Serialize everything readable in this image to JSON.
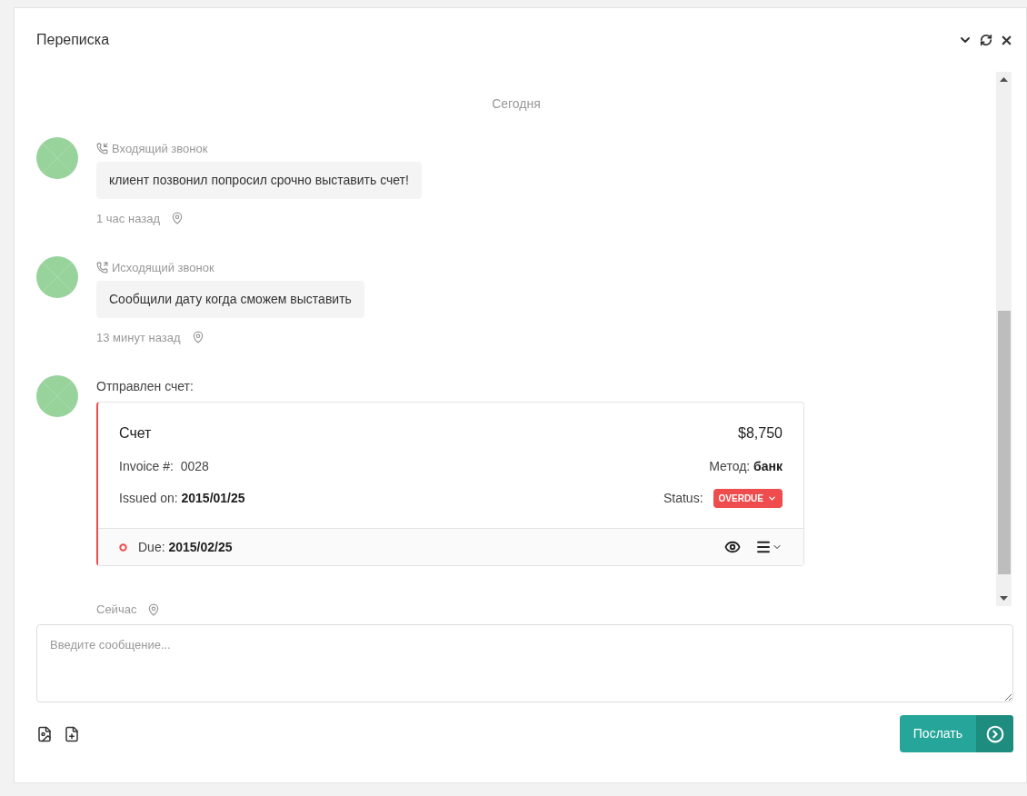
{
  "panel": {
    "title": "Переписка"
  },
  "feed": {
    "date_divider": "Сегодня",
    "items": [
      {
        "kind": "incoming_call",
        "label": "Входящий звонок",
        "text": "клиент позвонил попросил срочно выставить счет!",
        "time": "1 час назад"
      },
      {
        "kind": "outgoing_call",
        "label": "Исходящий звонок",
        "text": "Сообщили дату когда сможем выставить",
        "time": "13 минут назад"
      },
      {
        "kind": "invoice",
        "label": "Отправлен счет:",
        "invoice": {
          "title": "Счет",
          "amount": "$8,750",
          "number_label": "Invoice #:",
          "number": "0028",
          "method_label": "Метод:",
          "method": "банк",
          "issued_label": "Issued on:",
          "issued": "2015/01/25",
          "status_label": "Status:",
          "status": "OVERDUE",
          "due_label": "Due:",
          "due": "2015/02/25"
        },
        "time": "Сейчас"
      }
    ]
  },
  "composer": {
    "placeholder": "Введите сообщение...",
    "send": "Послать"
  }
}
